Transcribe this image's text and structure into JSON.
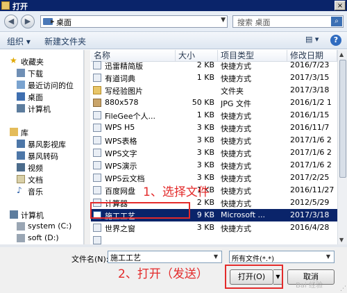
{
  "window": {
    "title": "打开",
    "close_glyph": "×"
  },
  "address": {
    "back": "◀",
    "forward": "▶",
    "path": "桌面",
    "chevron": "▸",
    "dropdown": "▼",
    "refresh": "↻"
  },
  "search": {
    "placeholder": "搜索 桌面",
    "icon_glyph": "⌕"
  },
  "toolbar": {
    "organize": "组织 ▾",
    "new_folder": "新建文件夹",
    "view_glyph": "▤ ▾",
    "help_glyph": "?"
  },
  "nav": {
    "favorites": "收藏夹",
    "favorite_items": [
      "下载",
      "最近访问的位",
      "桌面"
    ],
    "computer_short": "计算机",
    "libraries": "库",
    "library_items": [
      "暴风影视库",
      "暴风转码",
      "视频",
      "文档",
      "音乐"
    ],
    "computer": "计算机",
    "drives": [
      "system (C:)",
      "soft (D:)"
    ]
  },
  "columns": {
    "name": "名称",
    "size": "大小",
    "type": "项目类型",
    "date": "修改日期"
  },
  "files": [
    {
      "name": "迅雷精简版",
      "size": "2 KB",
      "type": "快捷方式",
      "date": "2016/7/23",
      "icon": "shortcut-icon"
    },
    {
      "name": "有道词典",
      "size": "1 KB",
      "type": "快捷方式",
      "date": "2017/3/15",
      "icon": "shortcut-icon"
    },
    {
      "name": "写经验图片",
      "size": "",
      "type": "文件夹",
      "date": "2017/3/18",
      "icon": "folder-icon"
    },
    {
      "name": "880x578",
      "size": "50 KB",
      "type": "JPG 文件",
      "date": "2016/1/2 1",
      "icon": "image-icon"
    },
    {
      "name": "FileGee个人...",
      "size": "1 KB",
      "type": "快捷方式",
      "date": "2016/1/15",
      "icon": "shortcut-icon"
    },
    {
      "name": "WPS H5",
      "size": "3 KB",
      "type": "快捷方式",
      "date": "2016/11/7",
      "icon": "shortcut-icon"
    },
    {
      "name": "WPS表格",
      "size": "3 KB",
      "type": "快捷方式",
      "date": "2017/1/6 2",
      "icon": "shortcut-icon"
    },
    {
      "name": "WPS文字",
      "size": "3 KB",
      "type": "快捷方式",
      "date": "2017/1/6 2",
      "icon": "shortcut-icon"
    },
    {
      "name": "WPS演示",
      "size": "3 KB",
      "type": "快捷方式",
      "date": "2017/1/6 2",
      "icon": "shortcut-icon"
    },
    {
      "name": "WPS云文档",
      "size": "3 KB",
      "type": "快捷方式",
      "date": "2017/2/25",
      "icon": "shortcut-icon"
    },
    {
      "name": "百度网盘",
      "size": "1 KB",
      "type": "快捷方式",
      "date": "2016/11/27",
      "icon": "shortcut-icon"
    },
    {
      "name": "计算器",
      "size": "2 KB",
      "type": "快捷方式",
      "date": "2012/5/29",
      "icon": "shortcut-icon"
    },
    {
      "name": "施工工艺",
      "size": "9 KB",
      "type": "Microsoft ...",
      "date": "2017/3/18",
      "icon": "word-doc-icon",
      "selected": true
    },
    {
      "name": "世界之窗",
      "size": "3 KB",
      "type": "快捷方式",
      "date": "2016/4/28",
      "icon": "shortcut-icon"
    },
    {
      "name": "",
      "size": "",
      "type": "",
      "date": "",
      "icon": "shortcut-icon"
    }
  ],
  "filename": {
    "label": "文件名(N):",
    "value": "施工工艺",
    "dropdown": "▼"
  },
  "filetype": {
    "value": "所有文件(*.*)",
    "dropdown": "▼"
  },
  "buttons": {
    "open": "打开(O)",
    "open_split": "▼",
    "cancel": "取消"
  },
  "annotations": {
    "step1": "1、选择文件",
    "step2": "2、打开（发送）"
  },
  "watermark": "Bai 经验",
  "colors": {
    "selection": "#0a246a",
    "annotation": "#e32a2a",
    "title_bar": "#0a246a"
  }
}
